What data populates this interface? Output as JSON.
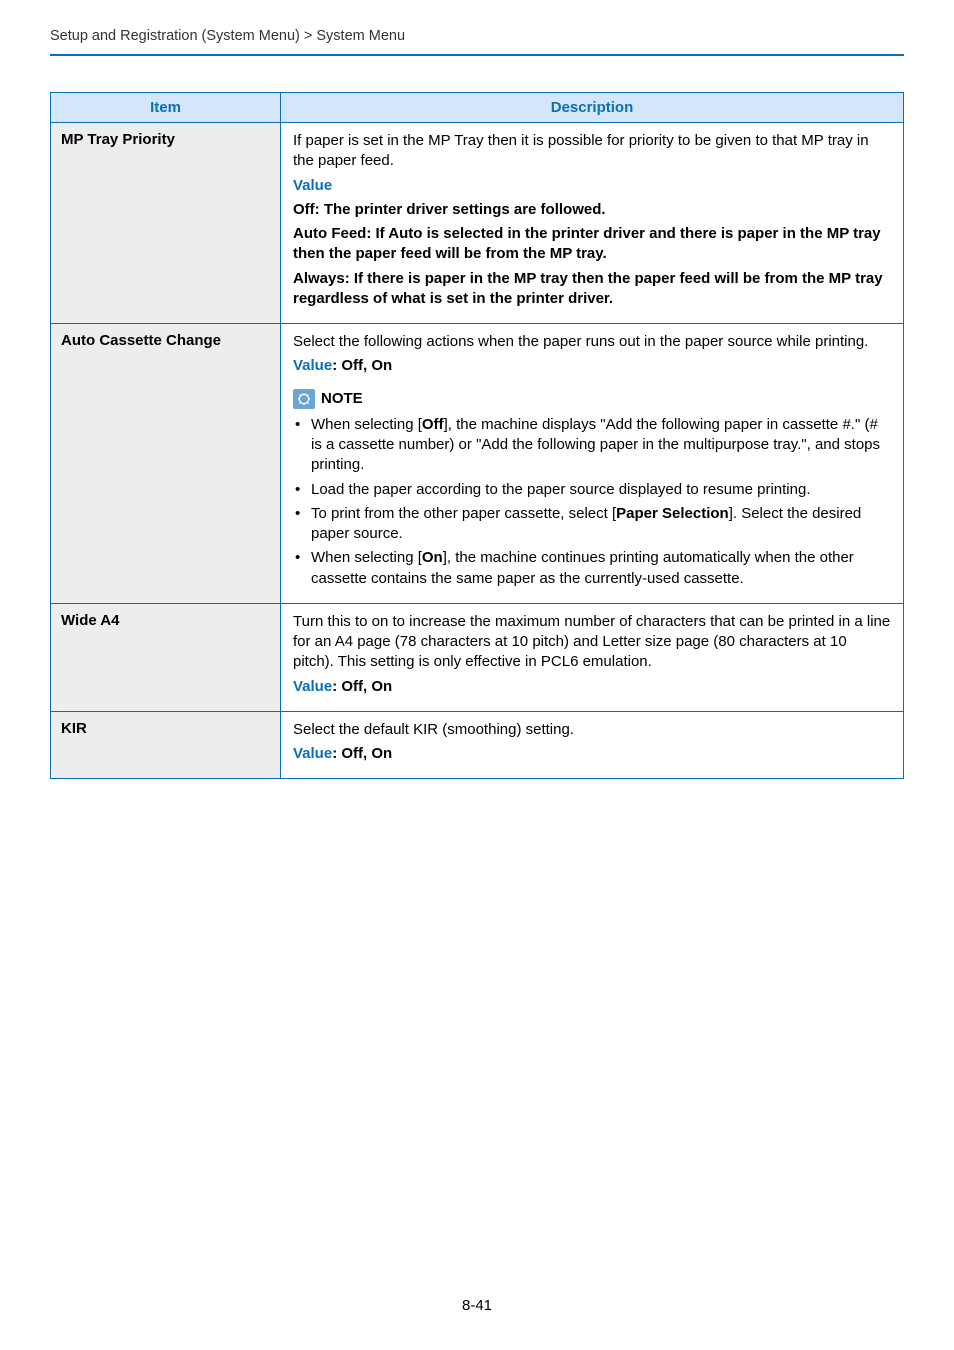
{
  "breadcrumb": "Setup and Registration (System Menu) > System Menu",
  "page_number": "8-41",
  "table": {
    "headers": {
      "item": "Item",
      "description": "Description"
    },
    "rows": {
      "mp_tray": {
        "item": "MP Tray Priority",
        "p1": "If paper is set in the MP Tray then it is possible for priority to be given to that MP tray in the paper feed.",
        "value_label": "Value",
        "p2": "Off: The printer driver settings are followed.",
        "p3": "Auto Feed: If Auto is selected in the printer driver and there is paper in the MP tray then the paper feed will be from the MP tray.",
        "p4": "Always: If there is paper in the MP tray then the paper feed will be from the MP tray regardless of what is set in the printer driver."
      },
      "auto_cassette": {
        "item": "Auto Cassette Change",
        "p1": "Select the following actions when the paper runs out in the paper source while printing.",
        "value_prefix": "Value",
        "value_text": ": Off, On",
        "note_label": "NOTE",
        "b1a": "When selecting [",
        "b1b": "Off",
        "b1c": "], the machine displays \"Add the following paper in cassette #.\" (# is a cassette number) or \"Add the following paper in the multipurpose tray.\", and stops printing.",
        "b2": "Load the paper according to the paper source displayed to resume printing.",
        "b3a": "To print from the other paper cassette, select [",
        "b3b": "Paper Selection",
        "b3c": "]. Select the desired paper source.",
        "b4a": "When selecting [",
        "b4b": "On",
        "b4c": "], the machine continues printing automatically when the other cassette contains the same paper as the currently-used cassette."
      },
      "wide_a4": {
        "item": "Wide A4",
        "p1": "Turn this to on to increase the maximum number of characters that can be printed in a line for an A4 page (78 characters at 10 pitch) and Letter size page (80 characters at 10 pitch). This setting is only effective in PCL6 emulation.",
        "value_prefix": "Value",
        "value_text": ": Off, On"
      },
      "kir": {
        "item": "KIR",
        "p1": "Select the default KIR (smoothing) setting.",
        "value_prefix": "Value",
        "value_text": ": Off, On"
      }
    }
  }
}
